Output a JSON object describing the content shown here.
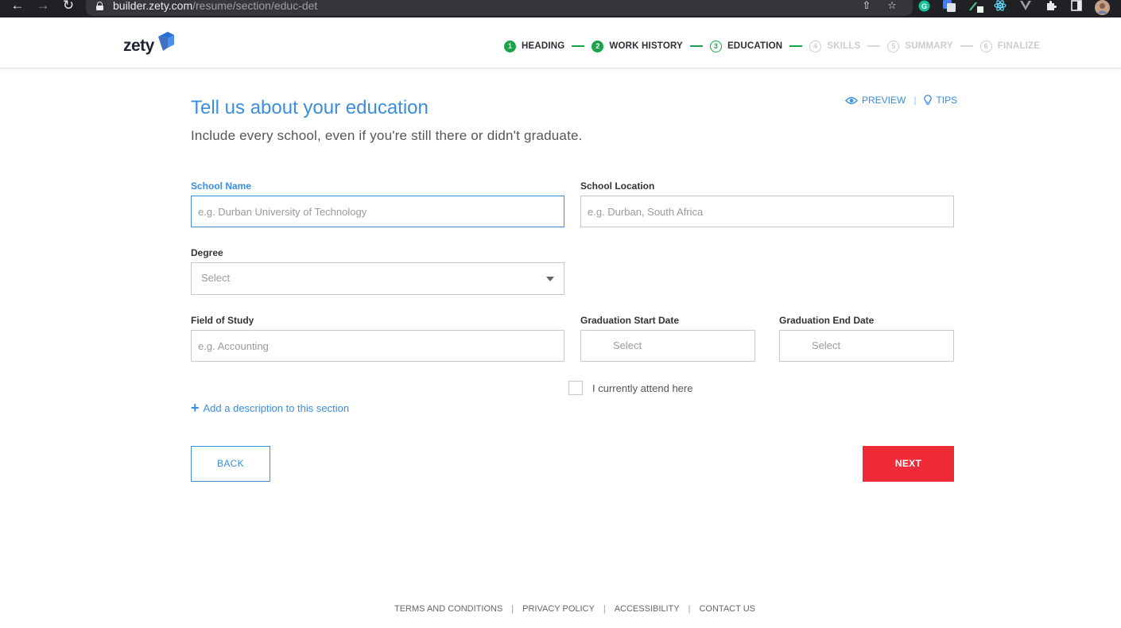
{
  "browser": {
    "url_host": "builder.zety.com",
    "url_path": "/resume/section/educ-det",
    "icons": [
      "back-icon",
      "forward-icon",
      "reload-icon",
      "lock-icon",
      "share-icon",
      "star-icon",
      "grammarly-icon",
      "translate-icon",
      "extension-icon",
      "react-devtools-icon",
      "vue-devtools-icon",
      "puzzle-icon",
      "sidebar-icon",
      "profile-avatar"
    ]
  },
  "header": {
    "logo_text": "zety",
    "steps": [
      {
        "num": "1",
        "label": "HEADING",
        "state": "done"
      },
      {
        "num": "2",
        "label": "WORK HISTORY",
        "state": "done"
      },
      {
        "num": "3",
        "label": "EDUCATION",
        "state": "active"
      },
      {
        "num": "4",
        "label": "SKILLS",
        "state": "todo"
      },
      {
        "num": "5",
        "label": "SUMMARY",
        "state": "todo"
      },
      {
        "num": "6",
        "label": "FINALIZE",
        "state": "todo"
      }
    ]
  },
  "main": {
    "title": "Tell us about your education",
    "subtitle": "Include every school, even if you're still there or didn't graduate.",
    "preview_label": "PREVIEW",
    "tips_label": "TIPS",
    "separator": "|",
    "school_name": {
      "label": "School Name",
      "placeholder": "e.g. Durban University of Technology",
      "value": ""
    },
    "school_location": {
      "label": "School Location",
      "placeholder": "e.g. Durban, South Africa",
      "value": ""
    },
    "degree": {
      "label": "Degree",
      "selected": "Select"
    },
    "field_of_study": {
      "label": "Field of Study",
      "placeholder": "e.g. Accounting",
      "value": ""
    },
    "grad_start": {
      "label": "Graduation Start Date",
      "selected": "Select"
    },
    "grad_end": {
      "label": "Graduation End Date",
      "selected": "Select"
    },
    "currently_attend": {
      "label": "I currently attend here",
      "checked": false
    },
    "add_description": {
      "plus": "+",
      "label": "Add a description to this section"
    },
    "back_button": "BACK",
    "next_button": "NEXT"
  },
  "footer": {
    "links": [
      "TERMS AND CONDITIONS",
      "PRIVACY POLICY",
      "ACCESSIBILITY",
      "CONTACT US"
    ],
    "separator": "|"
  },
  "colors": {
    "accent_blue": "#3a8de0",
    "step_green": "#1aa34a",
    "next_red": "#ef2b37",
    "browser_dark": "#202124"
  }
}
